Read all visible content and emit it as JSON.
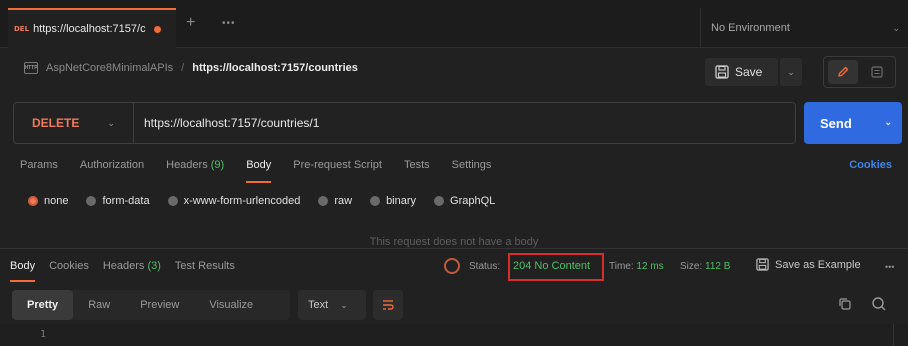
{
  "tab": {
    "method_mini": "DEL",
    "url": "https://localhost:7157/c",
    "plus": "+",
    "more": "•••"
  },
  "environment": {
    "label": "No Environment"
  },
  "breadcrumb": {
    "icon_text": "HTTP",
    "collection": "AspNetCore8MinimalAPIs",
    "separator": "/",
    "request": "https://localhost:7157/countries"
  },
  "toolbar": {
    "save_label": "Save"
  },
  "request": {
    "method": "DELETE",
    "url": "https://localhost:7157/countries/1",
    "send_label": "Send"
  },
  "request_tabs": [
    {
      "label": "Params",
      "count": ""
    },
    {
      "label": "Authorization",
      "count": ""
    },
    {
      "label": "Headers",
      "count": "(9)"
    },
    {
      "label": "Body",
      "count": ""
    },
    {
      "label": "Pre-request Script",
      "count": ""
    },
    {
      "label": "Tests",
      "count": ""
    },
    {
      "label": "Settings",
      "count": ""
    }
  ],
  "cookies_label": "Cookies",
  "body_options": [
    "none",
    "form-data",
    "x-www-form-urlencoded",
    "raw",
    "binary",
    "GraphQL"
  ],
  "body_selected": "none",
  "no_body_text": "This request does not have a body",
  "response_tabs": [
    {
      "label": "Body",
      "count": ""
    },
    {
      "label": "Cookies",
      "count": ""
    },
    {
      "label": "Headers",
      "count": "(3)"
    },
    {
      "label": "Test Results",
      "count": ""
    }
  ],
  "response_meta": {
    "status_label": "Status:",
    "status_value": "204 No Content",
    "time_label": "Time:",
    "time_value": "12 ms",
    "size_label": "Size:",
    "size_value": "112 B",
    "save_example": "Save as Example",
    "more": "•••"
  },
  "view_modes": [
    "Pretty",
    "Raw",
    "Preview",
    "Visualize"
  ],
  "format": "Text",
  "editor": {
    "line_number": "1"
  },
  "colors": {
    "accent": "#f26b3a",
    "send": "#2f6ae0",
    "success": "#4fbf67",
    "highlight": "#d62d2d",
    "link": "#3f86e8"
  }
}
